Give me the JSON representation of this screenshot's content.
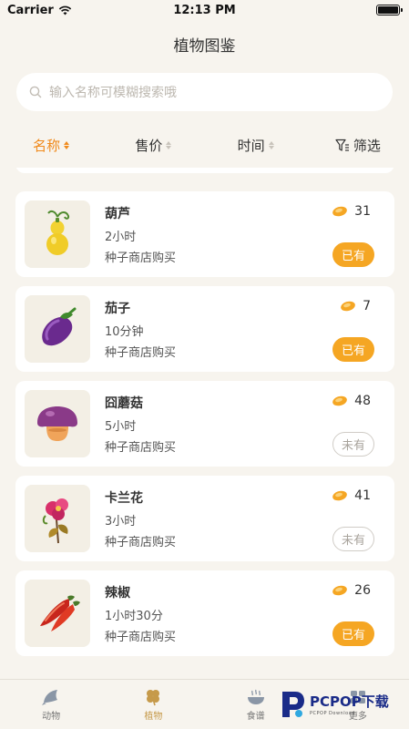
{
  "status": {
    "carrier": "Carrier",
    "time": "12:13 PM",
    "battery_level": 1.0
  },
  "header": {
    "title": "植物图鉴"
  },
  "search": {
    "placeholder": "输入名称可模糊搜索哦"
  },
  "sort": {
    "name_label": "名称",
    "price_label": "售价",
    "time_label": "时间",
    "filter_label": "筛选",
    "active": "name"
  },
  "plants": [
    {
      "name": "葫芦",
      "time": "2小时",
      "source": "种子商店购买",
      "price": "31",
      "status": "已有",
      "owned": true,
      "icon": "gourd-icon"
    },
    {
      "name": "茄子",
      "time": "10分钟",
      "source": "种子商店购买",
      "price": "7",
      "status": "已有",
      "owned": true,
      "icon": "eggplant-icon"
    },
    {
      "name": "囧蘑菇",
      "time": "5小时",
      "source": "种子商店购买",
      "price": "48",
      "status": "未有",
      "owned": false,
      "icon": "mushroom-icon"
    },
    {
      "name": "卡兰花",
      "time": "3小时",
      "source": "种子商店购买",
      "price": "41",
      "status": "未有",
      "owned": false,
      "icon": "kalan-flower-icon"
    },
    {
      "name": "辣椒",
      "time": "1小时30分",
      "source": "种子商店购买",
      "price": "26",
      "status": "已有",
      "owned": true,
      "icon": "chili-icon"
    }
  ],
  "tabs": [
    {
      "label": "动物",
      "icon": "fish-icon",
      "active": false
    },
    {
      "label": "植物",
      "icon": "clover-icon",
      "active": true
    },
    {
      "label": "食谱",
      "icon": "bowl-icon",
      "active": false
    },
    {
      "label": "更多",
      "icon": "more-icon",
      "active": false
    }
  ],
  "watermark": {
    "main": "PCPOP下载",
    "sub": "PCPOP Download"
  },
  "colors": {
    "accent": "#f08a1c",
    "owned_badge": "#f5a623",
    "background": "#f7f4ee"
  }
}
